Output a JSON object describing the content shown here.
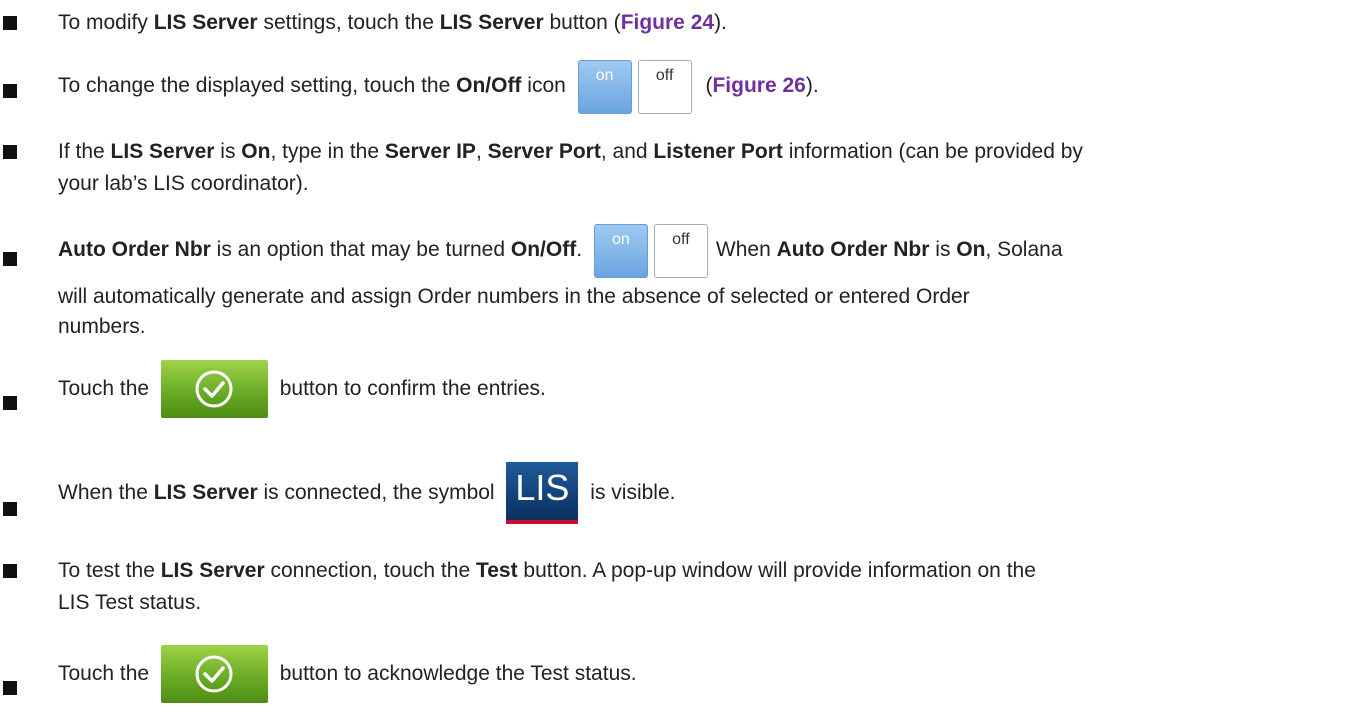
{
  "items": [
    {
      "t1": "To modify ",
      "b1": "LIS Server",
      "t2": " settings, touch the ",
      "b2": "LIS Server",
      "t3": " button (",
      "fig": "Figure 24",
      "t4": ")."
    },
    {
      "t1": "To change the displayed setting, touch the ",
      "b1": "On/Off",
      "t2": " icon",
      "t3": " (",
      "fig": "Figure 26",
      "t4": ")."
    },
    {
      "t1": "If the ",
      "b1": "LIS Server",
      "t2": " is ",
      "b2": "On",
      "t3": ", type in the ",
      "b3": "Server IP",
      "t4": ", ",
      "b4": "Server Port",
      "t5": ", and ",
      "b5": "Listener Port",
      "t6": " information (can be provided by",
      "line2": "your lab’s LIS coordinator)."
    },
    {
      "b1": "Auto Order Nbr",
      "t1": " is an option that may be turned ",
      "b2": "On/Off",
      "t2": ".",
      "t3": "When ",
      "b3": "Auto Order Nbr",
      "t4": " is ",
      "b4": "On",
      "t5": ", Solana",
      "line2": "will automatically generate and assign Order numbers in the absence of selected or entered Order",
      "line3": "numbers."
    },
    {
      "t1": "Touch the ",
      "t2": " button to confirm the entries."
    },
    {
      "t1": "When the ",
      "b1": "LIS Server",
      "t2": " is connected, the symbol ",
      "t3": " is visible."
    },
    {
      "t1": "To test the ",
      "b1": "LIS Server",
      "t2": " connection, touch the ",
      "b2": "Test",
      "t3": " button. A pop-up window will provide information on the",
      "line2": "LIS Test status."
    },
    {
      "t1": "Touch the ",
      "t2": " button to acknowledge the Test status."
    }
  ],
  "toggle": {
    "on": "on",
    "off": "off"
  },
  "lis_badge": "LIS",
  "icons": {
    "confirm": "check-circle-icon",
    "bullet": "square-bullet"
  },
  "colors": {
    "figure_ref": "#7030a0",
    "confirm_green": "#66a924",
    "lis_blue": "#0b2e5c",
    "lis_underline": "#c8102e"
  }
}
